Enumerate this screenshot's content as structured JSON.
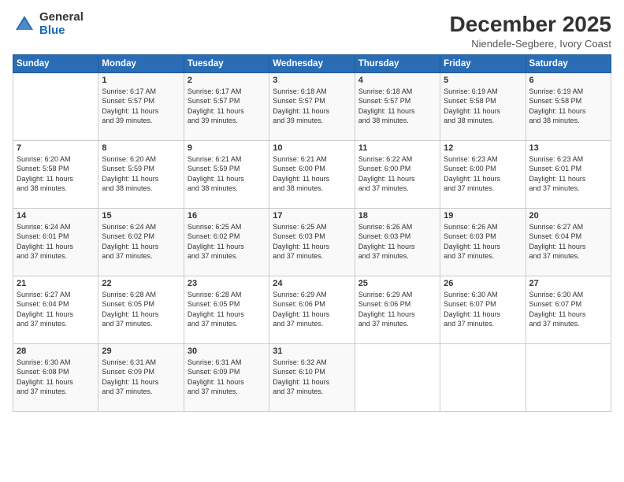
{
  "logo": {
    "general": "General",
    "blue": "Blue"
  },
  "header": {
    "month": "December 2025",
    "location": "Niendele-Segbere, Ivory Coast"
  },
  "days_of_week": [
    "Sunday",
    "Monday",
    "Tuesday",
    "Wednesday",
    "Thursday",
    "Friday",
    "Saturday"
  ],
  "weeks": [
    [
      {
        "day": "",
        "info": ""
      },
      {
        "day": "1",
        "info": "Sunrise: 6:17 AM\nSunset: 5:57 PM\nDaylight: 11 hours\nand 39 minutes."
      },
      {
        "day": "2",
        "info": "Sunrise: 6:17 AM\nSunset: 5:57 PM\nDaylight: 11 hours\nand 39 minutes."
      },
      {
        "day": "3",
        "info": "Sunrise: 6:18 AM\nSunset: 5:57 PM\nDaylight: 11 hours\nand 39 minutes."
      },
      {
        "day": "4",
        "info": "Sunrise: 6:18 AM\nSunset: 5:57 PM\nDaylight: 11 hours\nand 38 minutes."
      },
      {
        "day": "5",
        "info": "Sunrise: 6:19 AM\nSunset: 5:58 PM\nDaylight: 11 hours\nand 38 minutes."
      },
      {
        "day": "6",
        "info": "Sunrise: 6:19 AM\nSunset: 5:58 PM\nDaylight: 11 hours\nand 38 minutes."
      }
    ],
    [
      {
        "day": "7",
        "info": "Sunrise: 6:20 AM\nSunset: 5:58 PM\nDaylight: 11 hours\nand 38 minutes."
      },
      {
        "day": "8",
        "info": "Sunrise: 6:20 AM\nSunset: 5:59 PM\nDaylight: 11 hours\nand 38 minutes."
      },
      {
        "day": "9",
        "info": "Sunrise: 6:21 AM\nSunset: 5:59 PM\nDaylight: 11 hours\nand 38 minutes."
      },
      {
        "day": "10",
        "info": "Sunrise: 6:21 AM\nSunset: 6:00 PM\nDaylight: 11 hours\nand 38 minutes."
      },
      {
        "day": "11",
        "info": "Sunrise: 6:22 AM\nSunset: 6:00 PM\nDaylight: 11 hours\nand 37 minutes."
      },
      {
        "day": "12",
        "info": "Sunrise: 6:23 AM\nSunset: 6:00 PM\nDaylight: 11 hours\nand 37 minutes."
      },
      {
        "day": "13",
        "info": "Sunrise: 6:23 AM\nSunset: 6:01 PM\nDaylight: 11 hours\nand 37 minutes."
      }
    ],
    [
      {
        "day": "14",
        "info": "Sunrise: 6:24 AM\nSunset: 6:01 PM\nDaylight: 11 hours\nand 37 minutes."
      },
      {
        "day": "15",
        "info": "Sunrise: 6:24 AM\nSunset: 6:02 PM\nDaylight: 11 hours\nand 37 minutes."
      },
      {
        "day": "16",
        "info": "Sunrise: 6:25 AM\nSunset: 6:02 PM\nDaylight: 11 hours\nand 37 minutes."
      },
      {
        "day": "17",
        "info": "Sunrise: 6:25 AM\nSunset: 6:03 PM\nDaylight: 11 hours\nand 37 minutes."
      },
      {
        "day": "18",
        "info": "Sunrise: 6:26 AM\nSunset: 6:03 PM\nDaylight: 11 hours\nand 37 minutes."
      },
      {
        "day": "19",
        "info": "Sunrise: 6:26 AM\nSunset: 6:03 PM\nDaylight: 11 hours\nand 37 minutes."
      },
      {
        "day": "20",
        "info": "Sunrise: 6:27 AM\nSunset: 6:04 PM\nDaylight: 11 hours\nand 37 minutes."
      }
    ],
    [
      {
        "day": "21",
        "info": "Sunrise: 6:27 AM\nSunset: 6:04 PM\nDaylight: 11 hours\nand 37 minutes."
      },
      {
        "day": "22",
        "info": "Sunrise: 6:28 AM\nSunset: 6:05 PM\nDaylight: 11 hours\nand 37 minutes."
      },
      {
        "day": "23",
        "info": "Sunrise: 6:28 AM\nSunset: 6:05 PM\nDaylight: 11 hours\nand 37 minutes."
      },
      {
        "day": "24",
        "info": "Sunrise: 6:29 AM\nSunset: 6:06 PM\nDaylight: 11 hours\nand 37 minutes."
      },
      {
        "day": "25",
        "info": "Sunrise: 6:29 AM\nSunset: 6:06 PM\nDaylight: 11 hours\nand 37 minutes."
      },
      {
        "day": "26",
        "info": "Sunrise: 6:30 AM\nSunset: 6:07 PM\nDaylight: 11 hours\nand 37 minutes."
      },
      {
        "day": "27",
        "info": "Sunrise: 6:30 AM\nSunset: 6:07 PM\nDaylight: 11 hours\nand 37 minutes."
      }
    ],
    [
      {
        "day": "28",
        "info": "Sunrise: 6:30 AM\nSunset: 6:08 PM\nDaylight: 11 hours\nand 37 minutes."
      },
      {
        "day": "29",
        "info": "Sunrise: 6:31 AM\nSunset: 6:09 PM\nDaylight: 11 hours\nand 37 minutes."
      },
      {
        "day": "30",
        "info": "Sunrise: 6:31 AM\nSunset: 6:09 PM\nDaylight: 11 hours\nand 37 minutes."
      },
      {
        "day": "31",
        "info": "Sunrise: 6:32 AM\nSunset: 6:10 PM\nDaylight: 11 hours\nand 37 minutes."
      },
      {
        "day": "",
        "info": ""
      },
      {
        "day": "",
        "info": ""
      },
      {
        "day": "",
        "info": ""
      }
    ]
  ]
}
